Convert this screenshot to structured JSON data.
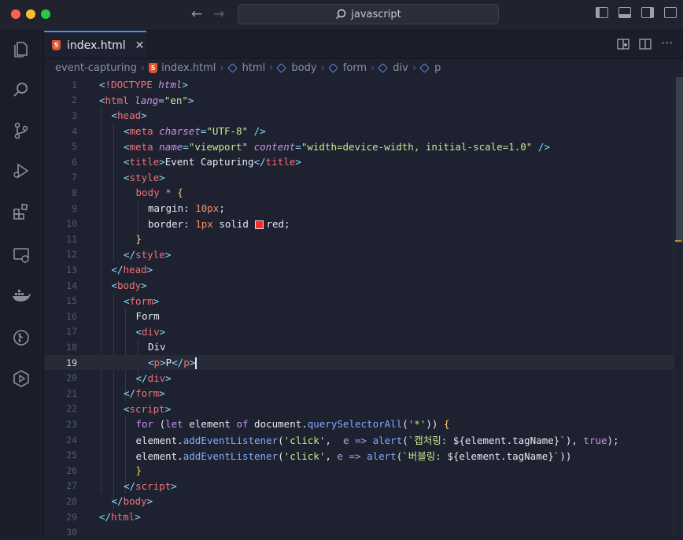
{
  "window": {
    "search_text": "javascript"
  },
  "tab": {
    "label": "index.html",
    "close": "✕"
  },
  "breadcrumb": [
    "event-capturing",
    "index.html",
    "html",
    "body",
    "form",
    "div",
    "p"
  ],
  "current_line": 19,
  "colors": {
    "tag": "#f07178",
    "attr": "#c792ea",
    "string": "#c3e88d",
    "number": "#f78c6c",
    "keyword": "#c792ea",
    "function": "#82aaff",
    "text": "#e6e8ee",
    "punct": "#89ddff"
  },
  "code_lines": [
    {
      "n": "1",
      "indent": 0,
      "tokens": [
        [
          "p",
          "<"
        ],
        [
          "t",
          "!DOCTYPE"
        ],
        [
          "x",
          " "
        ],
        [
          "a",
          "html"
        ],
        [
          "p",
          ">"
        ]
      ]
    },
    {
      "n": "2",
      "indent": 0,
      "tokens": [
        [
          "p",
          "<"
        ],
        [
          "t",
          "html"
        ],
        [
          "x",
          " "
        ],
        [
          "a",
          "lang"
        ],
        [
          "p",
          "="
        ],
        [
          "s",
          "\"en\""
        ],
        [
          "p",
          ">"
        ]
      ]
    },
    {
      "n": "3",
      "indent": 1,
      "tokens": [
        [
          "p",
          "<"
        ],
        [
          "t",
          "head"
        ],
        [
          "p",
          ">"
        ]
      ]
    },
    {
      "n": "4",
      "indent": 2,
      "tokens": [
        [
          "p",
          "<"
        ],
        [
          "t",
          "meta"
        ],
        [
          "x",
          " "
        ],
        [
          "a",
          "charset"
        ],
        [
          "p",
          "="
        ],
        [
          "s",
          "\"UTF-8\""
        ],
        [
          "x",
          " "
        ],
        [
          "p",
          "/>"
        ]
      ]
    },
    {
      "n": "5",
      "indent": 2,
      "tokens": [
        [
          "p",
          "<"
        ],
        [
          "t",
          "meta"
        ],
        [
          "x",
          " "
        ],
        [
          "a",
          "name"
        ],
        [
          "p",
          "="
        ],
        [
          "s",
          "\"viewport\""
        ],
        [
          "x",
          " "
        ],
        [
          "a",
          "content"
        ],
        [
          "p",
          "="
        ],
        [
          "s",
          "\"width=device-width, initial-scale=1.0\""
        ],
        [
          "x",
          " "
        ],
        [
          "p",
          "/>"
        ]
      ]
    },
    {
      "n": "6",
      "indent": 2,
      "tokens": [
        [
          "p",
          "<"
        ],
        [
          "t",
          "title"
        ],
        [
          "p",
          ">"
        ],
        [
          "x",
          "Event Capturing"
        ],
        [
          "p",
          "</"
        ],
        [
          "t",
          "title"
        ],
        [
          "p",
          ">"
        ]
      ]
    },
    {
      "n": "7",
      "indent": 2,
      "tokens": [
        [
          "p",
          "<"
        ],
        [
          "t",
          "style"
        ],
        [
          "p",
          ">"
        ]
      ]
    },
    {
      "n": "8",
      "indent": 3,
      "tokens": [
        [
          "t",
          "body"
        ],
        [
          "x",
          " "
        ],
        [
          "k",
          "*"
        ],
        [
          "x",
          " "
        ],
        [
          "y",
          "{"
        ]
      ]
    },
    {
      "n": "9",
      "indent": 4,
      "tokens": [
        [
          "x",
          "margin: "
        ],
        [
          "m",
          "10px"
        ],
        [
          "x",
          ";"
        ]
      ]
    },
    {
      "n": "10",
      "indent": 4,
      "tokens": [
        [
          "x",
          "border: "
        ],
        [
          "m",
          "1px"
        ],
        [
          "x",
          " solid "
        ],
        [
          "sw",
          ""
        ],
        [
          "x",
          "red;"
        ]
      ]
    },
    {
      "n": "11",
      "indent": 3,
      "tokens": [
        [
          "y",
          "}"
        ]
      ]
    },
    {
      "n": "12",
      "indent": 2,
      "tokens": [
        [
          "p",
          "</"
        ],
        [
          "t",
          "style"
        ],
        [
          "p",
          ">"
        ]
      ]
    },
    {
      "n": "13",
      "indent": 1,
      "tokens": [
        [
          "p",
          "</"
        ],
        [
          "t",
          "head"
        ],
        [
          "p",
          ">"
        ]
      ]
    },
    {
      "n": "14",
      "indent": 1,
      "tokens": [
        [
          "p",
          "<"
        ],
        [
          "t",
          "body"
        ],
        [
          "p",
          ">"
        ]
      ]
    },
    {
      "n": "15",
      "indent": 2,
      "tokens": [
        [
          "p",
          "<"
        ],
        [
          "t",
          "form"
        ],
        [
          "p",
          ">"
        ]
      ]
    },
    {
      "n": "16",
      "indent": 3,
      "tokens": [
        [
          "x",
          "Form"
        ]
      ]
    },
    {
      "n": "17",
      "indent": 3,
      "tokens": [
        [
          "p",
          "<"
        ],
        [
          "t",
          "div"
        ],
        [
          "p",
          ">"
        ]
      ]
    },
    {
      "n": "18",
      "indent": 4,
      "tokens": [
        [
          "x",
          "Div"
        ]
      ]
    },
    {
      "n": "19",
      "indent": 4,
      "tokens": [
        [
          "p",
          "<"
        ],
        [
          "t",
          "p"
        ],
        [
          "p",
          ">"
        ],
        [
          "x",
          "P"
        ],
        [
          "p",
          "</"
        ],
        [
          "t",
          "p"
        ],
        [
          "p",
          ">"
        ],
        [
          "c",
          ""
        ]
      ]
    },
    {
      "n": "20",
      "indent": 3,
      "tokens": [
        [
          "p",
          "</"
        ],
        [
          "t",
          "div"
        ],
        [
          "p",
          ">"
        ]
      ]
    },
    {
      "n": "21",
      "indent": 2,
      "tokens": [
        [
          "p",
          "</"
        ],
        [
          "t",
          "form"
        ],
        [
          "p",
          ">"
        ]
      ]
    },
    {
      "n": "22",
      "indent": 2,
      "tokens": [
        [
          "p",
          "<"
        ],
        [
          "t",
          "script"
        ],
        [
          "p",
          ">"
        ]
      ]
    },
    {
      "n": "23",
      "indent": 3,
      "tokens": [
        [
          "k",
          "for"
        ],
        [
          "x",
          " ("
        ],
        [
          "k",
          "let"
        ],
        [
          "x",
          " element "
        ],
        [
          "k",
          "of"
        ],
        [
          "x",
          " document."
        ],
        [
          "f",
          "querySelectorAll"
        ],
        [
          "x",
          "("
        ],
        [
          "s",
          "'*'"
        ],
        [
          "x",
          ")) "
        ],
        [
          "y",
          "{"
        ]
      ]
    },
    {
      "n": "24",
      "indent": 3,
      "tokens": [
        [
          "x",
          "element."
        ],
        [
          "f",
          "addEventListener"
        ],
        [
          "x",
          "("
        ],
        [
          "s",
          "'click'"
        ],
        [
          "x",
          ",  "
        ],
        [
          "k",
          "e"
        ],
        [
          "x",
          " "
        ],
        [
          "k",
          "=>"
        ],
        [
          "x",
          " "
        ],
        [
          "f",
          "alert"
        ],
        [
          "x",
          "("
        ],
        [
          "s",
          "`캡처링: "
        ],
        [
          "x",
          "${element.tagName}"
        ],
        [
          "s",
          "`"
        ],
        [
          "x",
          "), "
        ],
        [
          "k",
          "true"
        ],
        [
          "x",
          ");"
        ]
      ]
    },
    {
      "n": "25",
      "indent": 3,
      "tokens": [
        [
          "x",
          "element."
        ],
        [
          "f",
          "addEventListener"
        ],
        [
          "x",
          "("
        ],
        [
          "s",
          "'click'"
        ],
        [
          "x",
          ", "
        ],
        [
          "k",
          "e"
        ],
        [
          "x",
          " "
        ],
        [
          "k",
          "=>"
        ],
        [
          "x",
          " "
        ],
        [
          "f",
          "alert"
        ],
        [
          "x",
          "("
        ],
        [
          "s",
          "`버블링: "
        ],
        [
          "x",
          "${element.tagName}"
        ],
        [
          "s",
          "`"
        ],
        [
          "x",
          "))"
        ]
      ]
    },
    {
      "n": "26",
      "indent": 3,
      "tokens": [
        [
          "y",
          "}"
        ]
      ]
    },
    {
      "n": "27",
      "indent": 2,
      "tokens": [
        [
          "p",
          "</"
        ],
        [
          "t",
          "script"
        ],
        [
          "p",
          ">"
        ]
      ]
    },
    {
      "n": "28",
      "indent": 1,
      "tokens": [
        [
          "p",
          "</"
        ],
        [
          "t",
          "body"
        ],
        [
          "p",
          ">"
        ]
      ]
    },
    {
      "n": "29",
      "indent": 0,
      "tokens": [
        [
          "p",
          "</"
        ],
        [
          "t",
          "html"
        ],
        [
          "p",
          ">"
        ]
      ]
    },
    {
      "n": "30",
      "indent": 0,
      "tokens": []
    }
  ]
}
